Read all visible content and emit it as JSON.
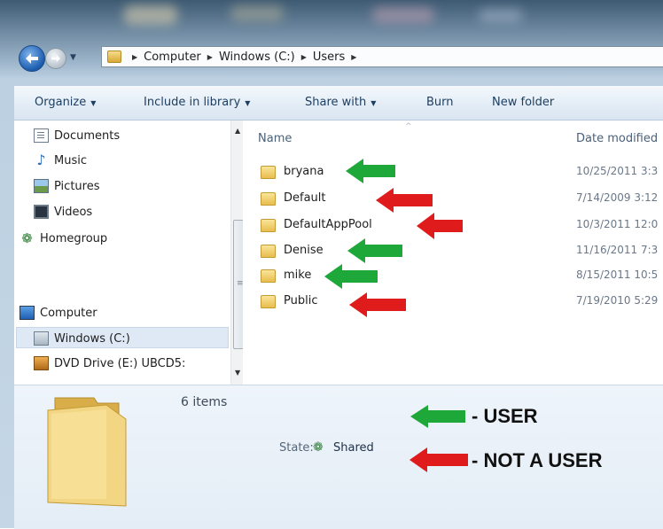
{
  "window": {
    "address": {
      "crumbs": [
        "Computer",
        "Windows (C:)",
        "Users"
      ]
    }
  },
  "toolbar": {
    "organize": "Organize",
    "include_in_library": "Include in library",
    "share_with": "Share with",
    "burn": "Burn",
    "new_folder": "New folder"
  },
  "nav": {
    "items": [
      {
        "label": "Documents",
        "icon": "documents-icon"
      },
      {
        "label": "Music",
        "icon": "music-icon"
      },
      {
        "label": "Pictures",
        "icon": "pictures-icon"
      },
      {
        "label": "Videos",
        "icon": "videos-icon"
      },
      {
        "label": "Homegroup",
        "icon": "homegroup-icon"
      },
      {
        "label": "Computer",
        "icon": "computer-icon"
      },
      {
        "label": "Windows (C:)",
        "icon": "drive-icon",
        "selected": true
      },
      {
        "label": "DVD Drive (E:) UBCD5:",
        "icon": "dvd-icon"
      }
    ]
  },
  "files": {
    "columns": {
      "name": "Name",
      "date": "Date modified"
    },
    "rows": [
      {
        "name": "bryana",
        "date": "10/25/2011 3:3",
        "marker": "green"
      },
      {
        "name": "Default",
        "date": "7/14/2009 3:12",
        "marker": "red"
      },
      {
        "name": "DefaultAppPool",
        "date": "10/3/2011 12:0",
        "marker": "red"
      },
      {
        "name": "Denise",
        "date": "11/16/2011 7:3",
        "marker": "green"
      },
      {
        "name": "mike",
        "date": "8/15/2011 10:5",
        "marker": "green"
      },
      {
        "name": "Public",
        "date": "7/19/2010 5:29",
        "marker": "red"
      }
    ]
  },
  "details": {
    "count": "6 items",
    "state_label": "State:",
    "state_value": "Shared"
  },
  "legend": {
    "user": "- USER",
    "not_user": "- NOT A USER"
  },
  "colors": {
    "green_arrow": "#1fa83a",
    "red_arrow": "#e01b1b",
    "selection": "#dfe9f5"
  }
}
